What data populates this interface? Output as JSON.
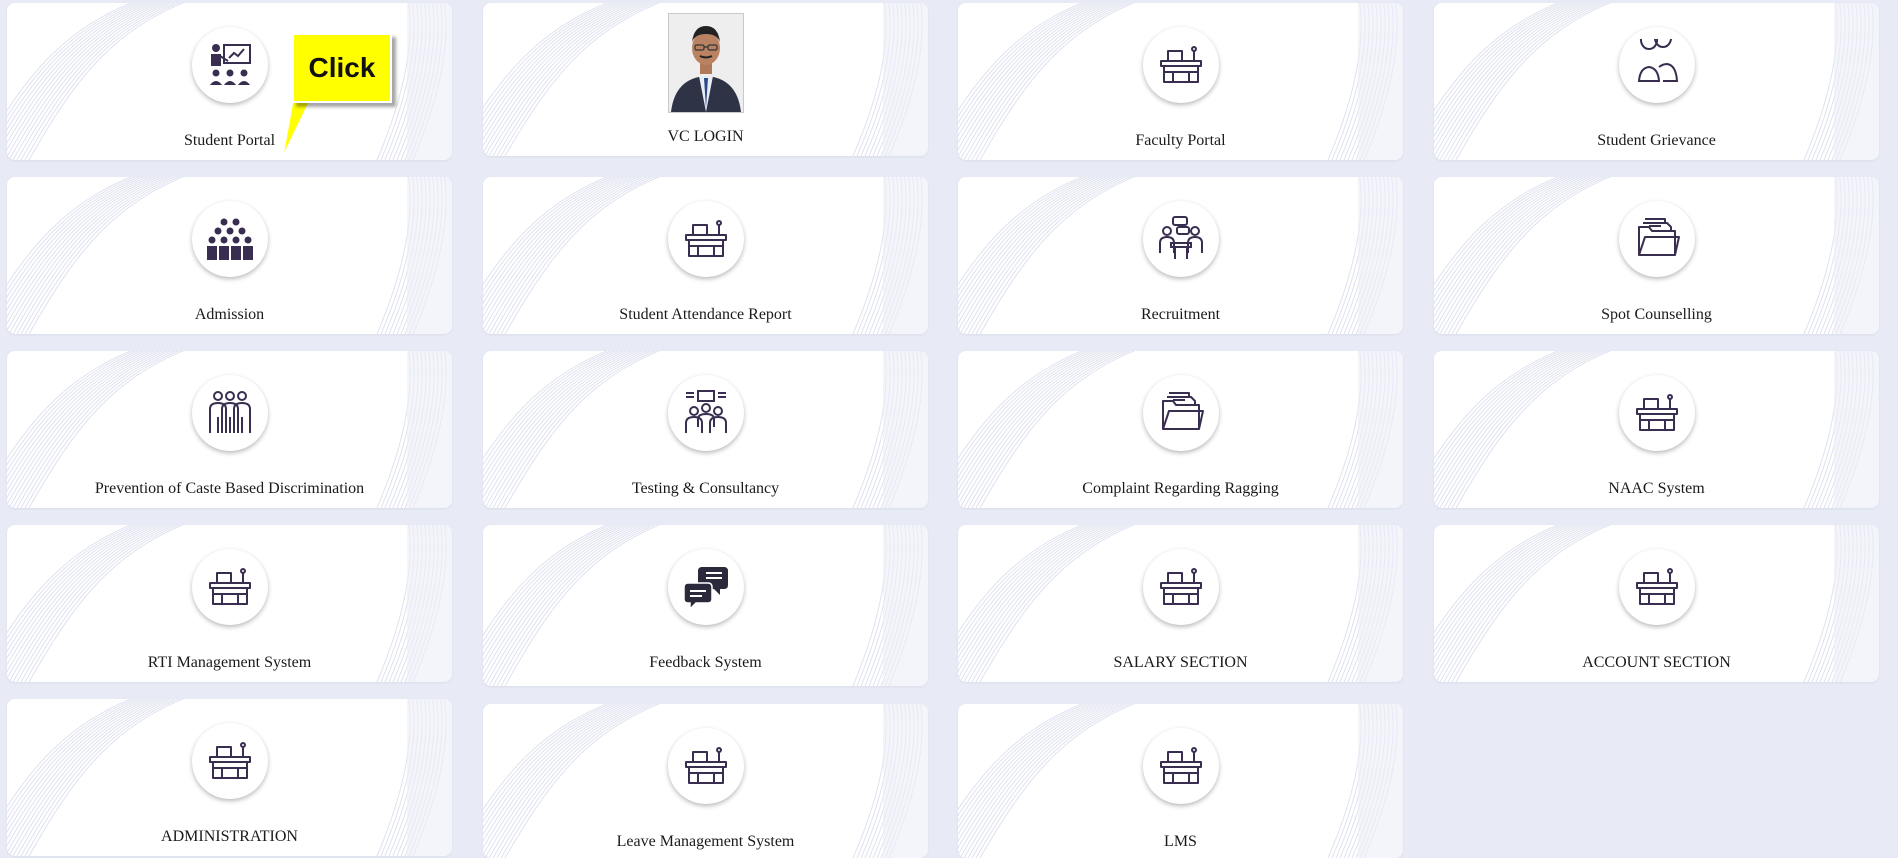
{
  "callout": {
    "text": "Click"
  },
  "icon_color": "#3a2e50",
  "callout_color": "#ffff00",
  "cards": [
    {
      "label": "Student Portal",
      "icon": "teacher-board-icon"
    },
    {
      "label": "VC LOGIN",
      "icon": "vc-portrait-photo"
    },
    {
      "label": "Faculty Portal",
      "icon": "desk-icon"
    },
    {
      "label": "Student Grievance",
      "icon": "users-icon"
    },
    {
      "label": "Admission",
      "icon": "crowd-icon"
    },
    {
      "label": "Student Attendance Report",
      "icon": "desk-icon"
    },
    {
      "label": "Recruitment",
      "icon": "interview-icon"
    },
    {
      "label": "Spot Counselling",
      "icon": "folder-icon"
    },
    {
      "label": "Prevention of Caste Based Discrimination",
      "icon": "group-icon"
    },
    {
      "label": "Testing & Consultancy",
      "icon": "meeting-icon"
    },
    {
      "label": "Complaint Regarding Ragging",
      "icon": "folder-icon"
    },
    {
      "label": "NAAC System",
      "icon": "desk-icon"
    },
    {
      "label": "RTI Management System",
      "icon": "desk-icon"
    },
    {
      "label": "Feedback System",
      "icon": "chat-bubbles-icon"
    },
    {
      "label": "SALARY SECTION",
      "icon": "desk-icon"
    },
    {
      "label": "ACCOUNT SECTION",
      "icon": "desk-icon"
    },
    {
      "label": "ADMINISTRATION",
      "icon": "desk-icon"
    },
    {
      "label": "Leave Management System",
      "icon": "desk-icon"
    },
    {
      "label": "LMS",
      "icon": "desk-icon"
    }
  ]
}
